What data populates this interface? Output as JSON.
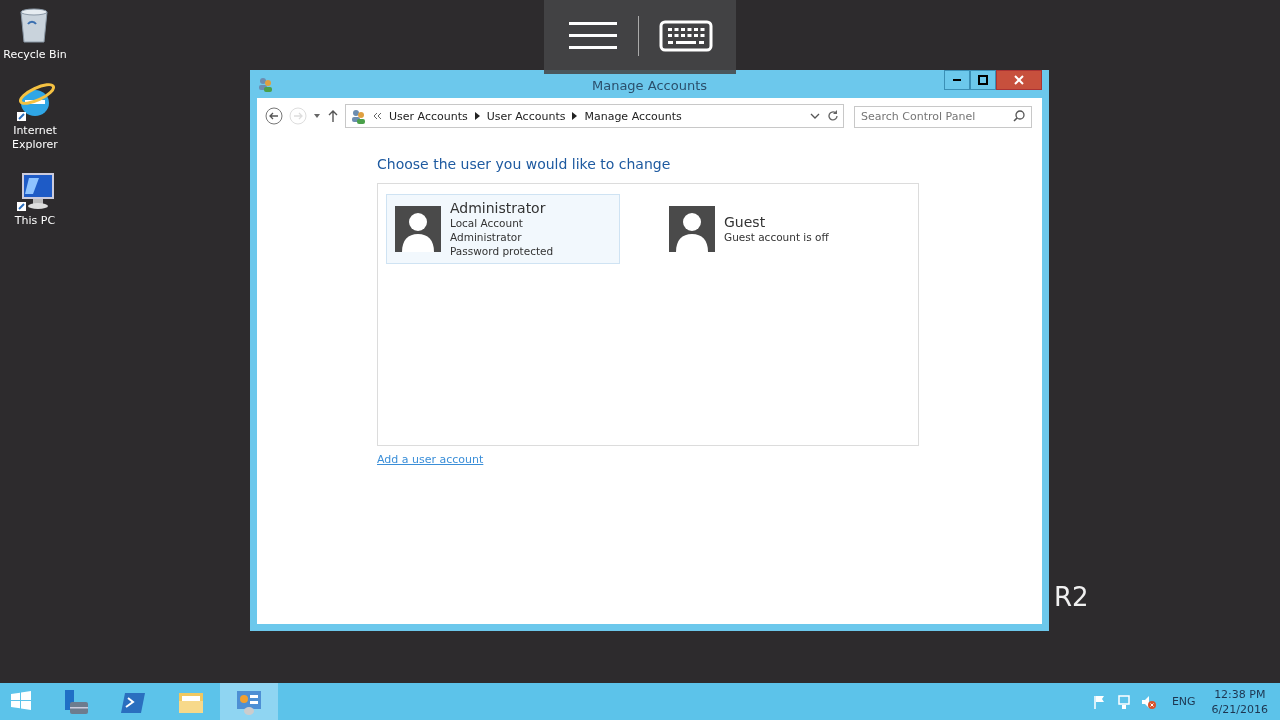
{
  "desktop_icons": [
    {
      "kind": "recycle-bin",
      "label": "Recycle Bin"
    },
    {
      "kind": "browser",
      "label": "Internet Explorer"
    },
    {
      "kind": "computer",
      "label": "This PC"
    }
  ],
  "wallpaper_text": "R2",
  "window": {
    "title": "Manage Accounts",
    "breadcrumb": [
      "User Accounts",
      "User Accounts",
      "Manage Accounts"
    ],
    "search": {
      "placeholder": "Search Control Panel"
    },
    "heading": "Choose the user you would like to change",
    "accounts": [
      {
        "name": "Administrator",
        "details": [
          "Local Account",
          "Administrator",
          "Password protected"
        ],
        "selected": true
      },
      {
        "name": "Guest",
        "details": [
          "Guest account is off"
        ],
        "selected": false
      }
    ],
    "link": "Add a user account"
  },
  "taskbar": {
    "apps": [
      {
        "kind": "start",
        "selected": false
      },
      {
        "kind": "server-manager",
        "selected": false
      },
      {
        "kind": "powershell",
        "selected": false
      },
      {
        "kind": "folder",
        "selected": false
      },
      {
        "kind": "control-panel",
        "selected": true
      }
    ],
    "tray": {
      "language": "ENG",
      "time": "12:38 PM",
      "date": "6/21/2016"
    }
  }
}
